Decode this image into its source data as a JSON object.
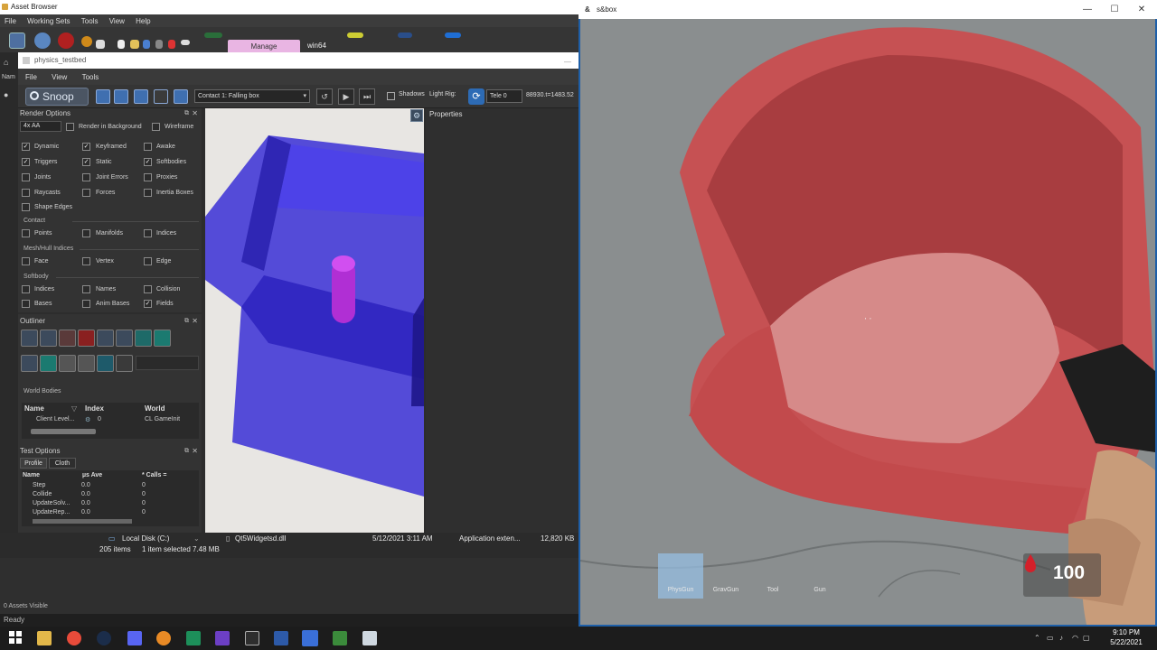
{
  "asset_browser": {
    "title": "Asset Browser",
    "menu": [
      "File",
      "Working Sets",
      "Tools",
      "View",
      "Help"
    ],
    "manage_tab": "Manage",
    "platform_label": "win64",
    "name_column": "Nam",
    "file_row": {
      "location": "Local Disk (C:)",
      "file_name": "Qt5Widgetsd.dll",
      "date": "5/12/2021 3:11 AM",
      "type": "Application exten...",
      "size": "12,820 KB"
    },
    "selection_status": {
      "items": "205 items",
      "selected": "1 item selected",
      "size": "7.48 MB"
    },
    "assets_visible": "0 Assets Visible",
    "status": "Ready"
  },
  "physics_testbed": {
    "title": "physics_testbed",
    "menu": [
      "File",
      "View",
      "Tools"
    ],
    "snoop_label": "Snoop",
    "contact_select": "Contact 1: Falling box",
    "shadows_label": "Shadows",
    "light_rig_label": "Light Rig:",
    "tele_select": "Tele 0",
    "coords_readout": "88930.t=1483.52",
    "properties_title": "Properties",
    "render_options": {
      "title": "Render Options",
      "aa_select": "4x AA",
      "render_in_background": "Render in Background",
      "wireframe": "Wireframe",
      "checks": [
        {
          "label": "Dynamic",
          "checked": true
        },
        {
          "label": "Keyframed",
          "checked": true
        },
        {
          "label": "Awake",
          "checked": false
        },
        {
          "label": "Triggers",
          "checked": true
        },
        {
          "label": "Static",
          "checked": true
        },
        {
          "label": "Softbodies",
          "checked": true
        },
        {
          "label": "Joints",
          "checked": false
        },
        {
          "label": "Joint Errors",
          "checked": false
        },
        {
          "label": "Proxies",
          "checked": false
        },
        {
          "label": "Raycasts",
          "checked": false
        },
        {
          "label": "Forces",
          "checked": false
        },
        {
          "label": "Inertia Boxes",
          "checked": false
        },
        {
          "label": "Shape Edges",
          "checked": false
        }
      ],
      "contact_section": "Contact",
      "contact_checks": [
        {
          "label": "Points",
          "checked": false
        },
        {
          "label": "Manifolds",
          "checked": false
        },
        {
          "label": "Indices",
          "checked": false
        }
      ],
      "mesh_section": "Mesh/Hull Indices",
      "mesh_checks": [
        {
          "label": "Face",
          "checked": false
        },
        {
          "label": "Vertex",
          "checked": false
        },
        {
          "label": "Edge",
          "checked": false
        }
      ],
      "softbody_section": "Softbody",
      "softbody_checks": [
        {
          "label": "Indices",
          "checked": false
        },
        {
          "label": "Names",
          "checked": false
        },
        {
          "label": "Collision",
          "checked": false
        },
        {
          "label": "Bases",
          "checked": false
        },
        {
          "label": "Anim Bases",
          "checked": false
        },
        {
          "label": "Fields",
          "checked": true
        }
      ]
    },
    "outliner": {
      "title": "Outliner",
      "world_bodies_label": "World Bodies",
      "columns": [
        "Name",
        "Index",
        "World"
      ],
      "row": {
        "name": "Client Level...",
        "index": "0",
        "world": "CL GameInit"
      }
    },
    "test_options": {
      "title": "Test Options",
      "tabs": [
        "Profile",
        "Cloth"
      ],
      "columns": [
        "Name",
        "µs Ave",
        "* Calls ="
      ],
      "rows": [
        {
          "name": "Step",
          "ave": "0.0",
          "calls": "0"
        },
        {
          "name": "Collide",
          "ave": "0.0",
          "calls": "0"
        },
        {
          "name": "UpdateSolv...",
          "ave": "0.0",
          "calls": "0"
        },
        {
          "name": "UpdateRep...",
          "ave": "0.0",
          "calls": "0"
        }
      ]
    }
  },
  "game": {
    "title": "s&box",
    "crosshair": "' '",
    "hotbar": [
      "PhysGun",
      "GravGun",
      "Tool",
      "Gun"
    ],
    "health": "100"
  },
  "taskbar": {
    "time": "9:10 PM",
    "date": "5/22/2021",
    "icons": [
      "start-icon",
      "file-explorer-icon",
      "chrome-icon",
      "steam-icon",
      "discord-icon",
      "blender-icon",
      "houdini-icon",
      "twitch-icon",
      "vrf-icon",
      "hammer-icon",
      "sbox-icon",
      "notepad-icon",
      "window-icon"
    ]
  }
}
